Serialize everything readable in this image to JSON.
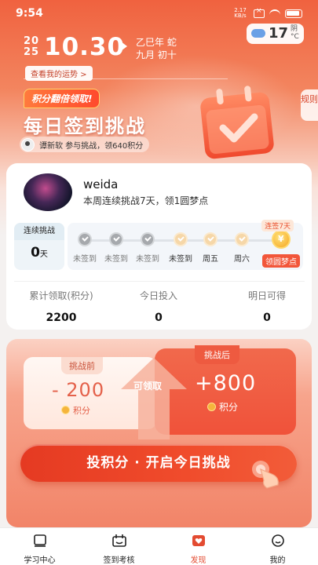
{
  "status_bar": {
    "time": "9:54",
    "network_speed": "2.17 KB/s",
    "battery_level": 0.8
  },
  "date": {
    "year_top": "20",
    "year_bottom": "25",
    "day": "10.30",
    "lunar_line1": "乙巳年 蛇",
    "lunar_line2": "九月 初十",
    "fortune_link": "查看我的运势 >"
  },
  "weather": {
    "temp": "17",
    "condition": "阴",
    "unit": "°C",
    "icon": "cloud-icon"
  },
  "rules_label": "规则",
  "banner": "积分翻倍领取!",
  "title": "每日签到挑战",
  "participants": "谭新软  参与挑战，领640积分",
  "user": {
    "name": "weida",
    "streak_text": "本周连续挑战7天，领1圆梦点"
  },
  "streak": {
    "label": "连续挑战",
    "value": "0",
    "unit": "天"
  },
  "week": {
    "reward_tag": "连签7天",
    "days": [
      {
        "label": "未签到",
        "state": "missed"
      },
      {
        "label": "未签到",
        "state": "missed"
      },
      {
        "label": "未签到",
        "state": "missed"
      },
      {
        "label": "未签到",
        "state": "future"
      },
      {
        "label": "周五",
        "state": "future"
      },
      {
        "label": "周六",
        "state": "future"
      },
      {
        "label": "领圆梦点",
        "state": "reward"
      }
    ]
  },
  "stats": [
    {
      "label": "累计领取(积分)",
      "value": "2200"
    },
    {
      "label": "今日投入",
      "value": "0"
    },
    {
      "label": "明日可得",
      "value": "0"
    }
  ],
  "challenge": {
    "before_label": "挑战前",
    "before_value": "- 200",
    "after_label": "挑战后",
    "after_value": "+800",
    "claim_label": "可领取",
    "unit": "积分",
    "cta": "投积分 · 开启今日挑战"
  },
  "tabs": [
    {
      "label": "学习中心",
      "icon": "book-icon",
      "active": false
    },
    {
      "label": "签到考核",
      "icon": "calendar-icon",
      "active": false
    },
    {
      "label": "发现",
      "icon": "discover-icon",
      "active": true
    },
    {
      "label": "我的",
      "icon": "profile-icon",
      "active": false
    }
  ],
  "colors": {
    "accent": "#f0523a",
    "active_tab": "#e34b31"
  }
}
